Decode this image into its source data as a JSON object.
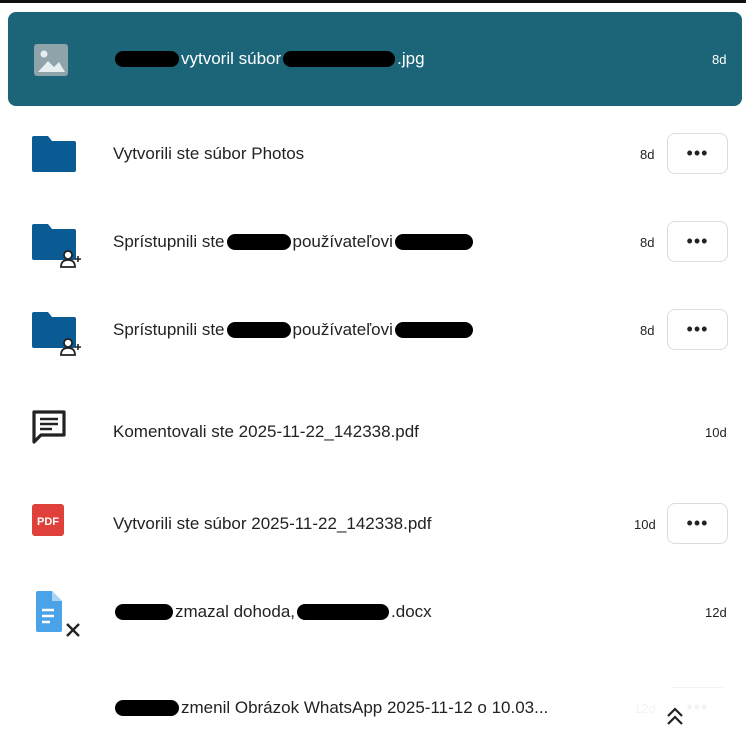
{
  "activities": [
    {
      "icon": "image-icon",
      "text_before": "",
      "redact1": "",
      "text_mid": "vytvoril súbor",
      "redact2": "",
      "text_after": ".jpg",
      "time": "8d",
      "highlighted": true,
      "has_menu": false
    },
    {
      "icon": "folder-icon",
      "text": "Vytvorili ste súbor Photos",
      "time": "8d",
      "has_menu": true
    },
    {
      "icon": "folder-share-icon",
      "text_before": "Sprístupnili ste",
      "text_mid": "používateľovi",
      "time": "8d",
      "has_menu": true
    },
    {
      "icon": "folder-share-icon",
      "text_before": "Sprístupnili ste",
      "text_mid": "používateľovi",
      "time": "8d",
      "has_menu": true
    },
    {
      "icon": "comment-icon",
      "text": "Komentovali ste 2025-11-22_142338.pdf",
      "time": "10d",
      "has_menu": false
    },
    {
      "icon": "pdf-icon",
      "text": "Vytvorili ste súbor 2025-11-22_142338.pdf",
      "time": "10d",
      "has_menu": true
    },
    {
      "icon": "document-deleted-icon",
      "text_mid": "zmazal dohoda,",
      "text_after": ".docx",
      "time": "12d",
      "has_menu": false
    },
    {
      "icon": "",
      "text_mid": "zmenil Obrázok WhatsApp 2025-11-12 o 10.03...",
      "time": "12d",
      "has_menu": true
    }
  ],
  "menu_label": "•••",
  "pdf_badge": "PDF",
  "colors": {
    "highlight": "#1c6478",
    "folder": "#0a5a94",
    "pdf": "#e0403a",
    "doc": "#4aa3e8"
  }
}
